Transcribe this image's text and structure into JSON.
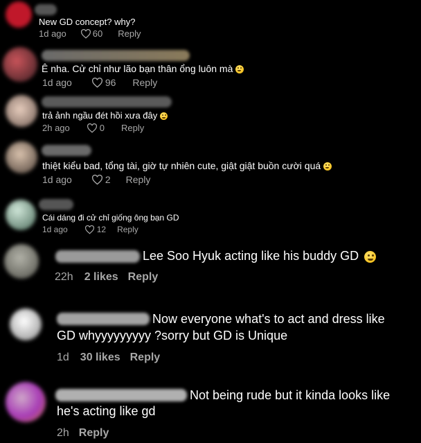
{
  "comments": [
    {
      "text": "New GD concept? why?",
      "time": "1d ago",
      "likes": "60",
      "reply": "Reply",
      "has_emoji": false,
      "avatar_color": "#c0182a"
    },
    {
      "text": "Ê nha. Cử chỉ như lão bạn thân ổng luôn mà",
      "time": "1d ago",
      "likes": "96",
      "reply": "Reply",
      "has_emoji": true,
      "avatar_color": "#8a3a3a"
    },
    {
      "text": "trả ảnh ngầu đét hồi xưa đây",
      "time": "2h ago",
      "likes": "0",
      "reply": "Reply",
      "has_emoji": true,
      "avatar_color": "#c9a99a"
    },
    {
      "text": "thiệt kiểu bad, tổng tài, giờ tự nhiên cute, giật giật buồn cười quá",
      "time": "1d ago",
      "likes": "2",
      "reply": "Reply",
      "has_emoji": true,
      "avatar_color": "#b89b86"
    },
    {
      "text": "Cái dáng đi cử chỉ giống ông bạn GD",
      "time": "1d ago",
      "likes": "12",
      "reply": "Reply",
      "has_emoji": false,
      "avatar_color": "#6f8a7a"
    }
  ],
  "replies": [
    {
      "lines": [
        "Lee Soo Hyuk acting like his buddy GD"
      ],
      "time": "22h",
      "likes": "2 likes",
      "reply": "Reply",
      "has_emoji": true,
      "avatar_color": "#8f8f86"
    },
    {
      "lines": [
        "Now everyone what's to act and dress like",
        "GD whyyyyyyyyy ?sorry but GD is Unique"
      ],
      "time": "1d",
      "likes": "30 likes",
      "reply": "Reply",
      "has_emoji": false,
      "avatar_color": "#d7d7d7"
    },
    {
      "lines": [
        "Not being rude but it kinda looks like",
        "he's acting like gd"
      ],
      "time": "2h",
      "likes": "",
      "reply": "Reply",
      "has_emoji": false,
      "avatar_color": "#9a4aa8"
    }
  ]
}
